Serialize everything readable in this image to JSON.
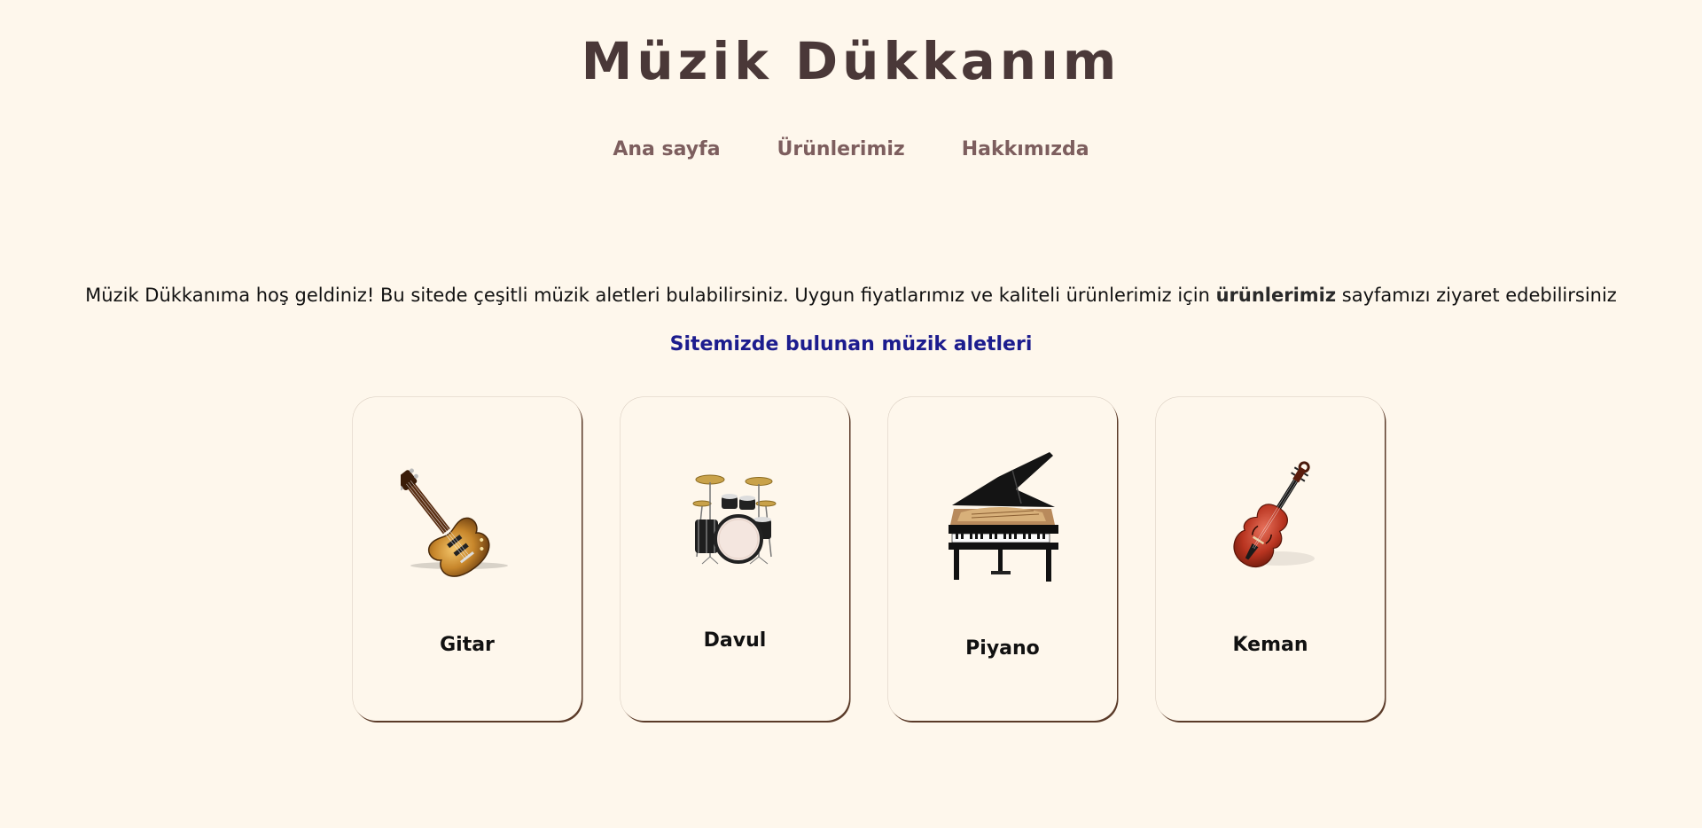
{
  "header": {
    "title": "Müzik Dükkanım"
  },
  "nav": {
    "items": [
      {
        "label": "Ana sayfa"
      },
      {
        "label": "Ürünlerimiz"
      },
      {
        "label": "Hakkımızda"
      }
    ]
  },
  "intro": {
    "text_before": "Müzik Dükkanıma hoş geldiniz! Bu sitede çeşitli müzik aletleri bulabilirsiniz. Uygun fiyatlarımız ve kaliteli ürünlerimiz için ",
    "link": "ürünlerimiz",
    "text_after": " sayfamızı ziyaret edebilirsiniz"
  },
  "section": {
    "title": "Sitemizde bulunan müzik aletleri"
  },
  "products": [
    {
      "name": "Gitar",
      "icon": "guitar-icon"
    },
    {
      "name": "Davul",
      "icon": "drum-kit-icon"
    },
    {
      "name": "Piyano",
      "icon": "grand-piano-icon"
    },
    {
      "name": "Keman",
      "icon": "violin-icon"
    }
  ],
  "colors": {
    "background": "#fef7ec",
    "title": "#4a3838",
    "nav": "#7d5e5e",
    "section_title": "#1c1c8e"
  }
}
